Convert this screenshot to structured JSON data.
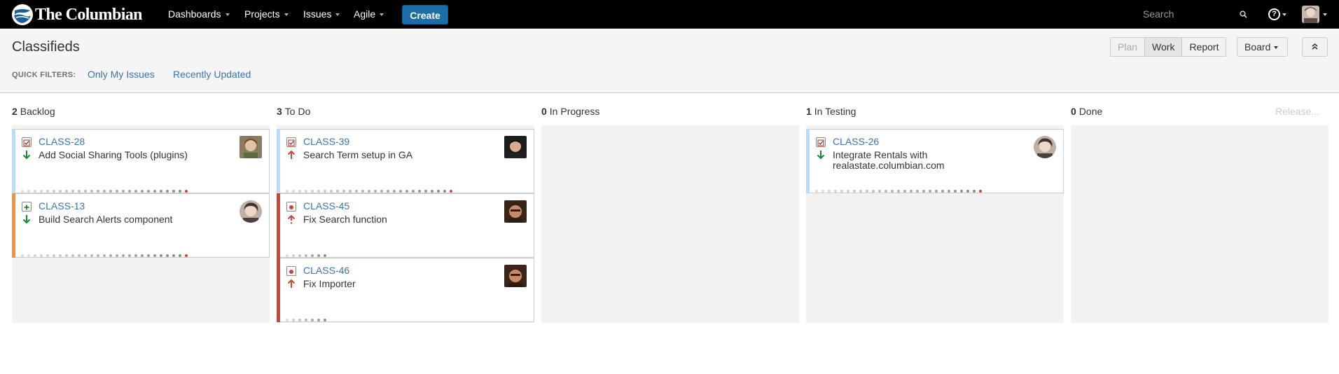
{
  "nav": {
    "logo_text": "The Columbian",
    "items": [
      {
        "label": "Dashboards"
      },
      {
        "label": "Projects"
      },
      {
        "label": "Issues"
      },
      {
        "label": "Agile"
      }
    ],
    "create_label": "Create",
    "search_placeholder": "Search",
    "help_glyph": "?"
  },
  "board": {
    "title": "Classifieds",
    "quick_filters_label": "QUICK FILTERS:",
    "quick_filters": [
      "Only My Issues",
      "Recently Updated"
    ],
    "modes": [
      "Plan",
      "Work",
      "Report"
    ],
    "board_menu_label": "Board",
    "release_label": "Release..."
  },
  "columns": [
    {
      "count": "2",
      "name": "Backlog"
    },
    {
      "count": "3",
      "name": "To Do"
    },
    {
      "count": "0",
      "name": "In Progress"
    },
    {
      "count": "1",
      "name": "In Testing"
    },
    {
      "count": "0",
      "name": "Done"
    }
  ],
  "cards": [
    {
      "key": "CLASS-28",
      "summary": "Add Social Sharing Tools (plugins)",
      "type": "task-icon",
      "priority": "low-priority-arrow-icon",
      "stripe_color": "#b6defa"
    },
    {
      "key": "CLASS-13",
      "summary": "Build Search Alerts component",
      "type": "new-feature-icon",
      "priority": "low-priority-arrow-icon",
      "stripe_color": "#f79232"
    },
    {
      "key": "CLASS-39",
      "summary": "Search Term setup in GA",
      "type": "task-icon",
      "priority": "high-priority-arrow-icon",
      "stripe_color": "#b6defa"
    },
    {
      "key": "CLASS-45",
      "summary": "Fix Search function",
      "type": "bug-icon",
      "priority": "critical-priority-icon",
      "stripe_color": "#d04437"
    },
    {
      "key": "CLASS-46",
      "summary": "Fix Importer",
      "type": "bug-icon",
      "priority": "high-priority-arrow-icon",
      "stripe_color": "#d04437"
    },
    {
      "key": "CLASS-26",
      "summary": "Integrate Rentals with realastate.columbian.com",
      "type": "task-icon",
      "priority": "low-priority-arrow-icon",
      "stripe_color": "#b6defa"
    }
  ],
  "colors": {
    "accent": "#3b73af",
    "create_button": "#1b6fa8",
    "low_priority": "#14892c",
    "high_priority": "#d04437"
  }
}
